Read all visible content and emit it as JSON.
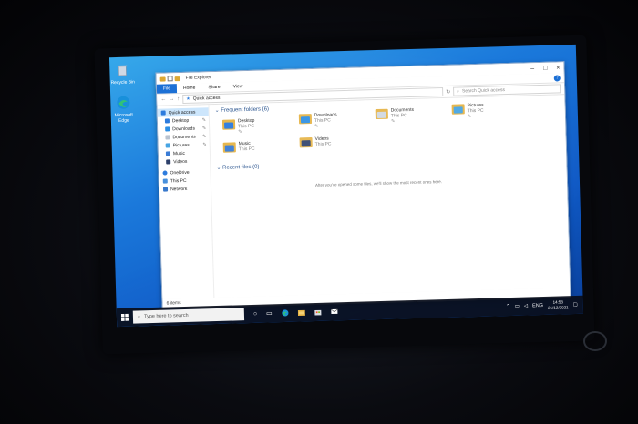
{
  "desktop": {
    "icons": [
      {
        "label": "Recycle Bin",
        "icon": "recycle-bin-icon"
      },
      {
        "label": "Microsoft Edge",
        "icon": "edge-icon"
      }
    ]
  },
  "window": {
    "title": "File Explorer",
    "ribbon_tabs": [
      "File",
      "Home",
      "Share",
      "View"
    ],
    "address": "Quick access",
    "search_placeholder": "Search Quick access",
    "nav_items": [
      {
        "label": "Quick access",
        "icon": "star-icon",
        "pinned": false,
        "selected": true
      },
      {
        "label": "Desktop",
        "icon": "desktop-icon",
        "pinned": true
      },
      {
        "label": "Downloads",
        "icon": "download-icon",
        "pinned": true
      },
      {
        "label": "Documents",
        "icon": "document-icon",
        "pinned": true
      },
      {
        "label": "Pictures",
        "icon": "pictures-icon",
        "pinned": true
      },
      {
        "label": "Music",
        "icon": "music-icon",
        "pinned": false
      },
      {
        "label": "Videos",
        "icon": "video-icon",
        "pinned": false
      },
      {
        "label": "OneDrive",
        "icon": "cloud-icon",
        "pinned": false
      },
      {
        "label": "This PC",
        "icon": "computer-icon",
        "pinned": false
      },
      {
        "label": "Network",
        "icon": "network-icon",
        "pinned": false
      }
    ],
    "frequent_header": "Frequent folders (6)",
    "folders": [
      {
        "name": "Desktop",
        "location": "This PC",
        "color": "#2f7bd8"
      },
      {
        "name": "Downloads",
        "location": "This PC",
        "color": "#2f8de0"
      },
      {
        "name": "Documents",
        "location": "This PC",
        "color": "#cfd6df"
      },
      {
        "name": "Pictures",
        "location": "This PC",
        "color": "#4aa3df"
      },
      {
        "name": "Music",
        "location": "This PC",
        "color": "#3b7bd1"
      },
      {
        "name": "Videos",
        "location": "This PC",
        "color": "#2c3e66"
      }
    ],
    "recent_header": "Recent files (0)",
    "empty_message": "After you've opened some files, we'll show the most recent ones here.",
    "status": "6 items"
  },
  "taskbar": {
    "search_placeholder": "Type here to search",
    "language": "ENG",
    "time": "14:58",
    "date": "21/12/2021"
  }
}
